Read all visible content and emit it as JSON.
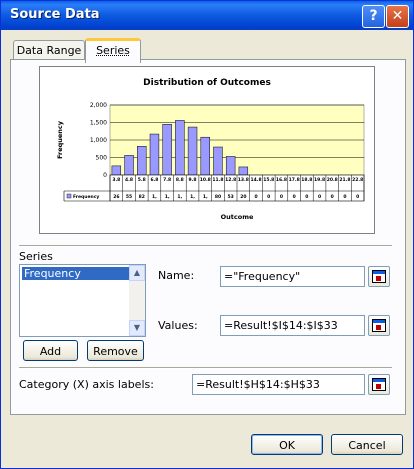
{
  "window": {
    "title": "Source Data"
  },
  "titlebar_buttons": {
    "help": "?",
    "close": "✕"
  },
  "tabs": [
    {
      "label": "Data Range",
      "active": false
    },
    {
      "label": "Series",
      "active": true
    }
  ],
  "chart_data": {
    "type": "bar",
    "title": "Distribution of Outcomes",
    "ylabel": "Frequency",
    "xlabel": "Outcome",
    "ylim": [
      0,
      2000
    ],
    "yticks": [
      "2,000",
      "1,500",
      "1,000",
      "500",
      "0"
    ],
    "legend": "Frequency",
    "legend_placement": "left of data table",
    "categories": [
      "3.8",
      "4.8",
      "5.8",
      "6.8",
      "7.8",
      "8.8",
      "9.8",
      "10.8",
      "11.8",
      "12.8",
      "13.8",
      "14.8",
      "15.8",
      "16.8",
      "17.8",
      "18.8",
      "19.8",
      "20.8",
      "21.8",
      "22.8"
    ],
    "values": [
      260,
      560,
      820,
      1170,
      1450,
      1560,
      1370,
      1080,
      800,
      530,
      230,
      0,
      0,
      0,
      0,
      0,
      0,
      0,
      0,
      0
    ],
    "table_row": [
      "26",
      "55",
      "82",
      "1,",
      "1,",
      "1,",
      "1,",
      "1,",
      "80",
      "53",
      "20",
      "0",
      "0",
      "0",
      "0",
      "0",
      "0",
      "0",
      "0",
      "0"
    ],
    "colors": {
      "plot_bg": "#ffffc0",
      "bar": "#9999ff",
      "bar_edge": "#000000"
    }
  },
  "series": {
    "label": "Series",
    "items": [
      "Frequency"
    ],
    "add_label": "Add",
    "remove_label": "Remove"
  },
  "fields": {
    "name_label": "Name:",
    "name_value": "=\"Frequency\"",
    "values_label": "Values:",
    "values_value": "=Result!$I$14:$I$33",
    "category_label": "Category (X) axis labels:",
    "category_value": "=Result!$H$14:$H$33"
  },
  "buttons": {
    "ok": "OK",
    "cancel": "Cancel"
  },
  "colors": {
    "titlebar": "#0a5fe6",
    "selection": "#316ac5",
    "active_tab_accent": "#ffc83c"
  },
  "icons": [
    "help-icon",
    "close-icon",
    "range-selector-icon",
    "scroll-up-icon",
    "scroll-down-icon"
  ]
}
